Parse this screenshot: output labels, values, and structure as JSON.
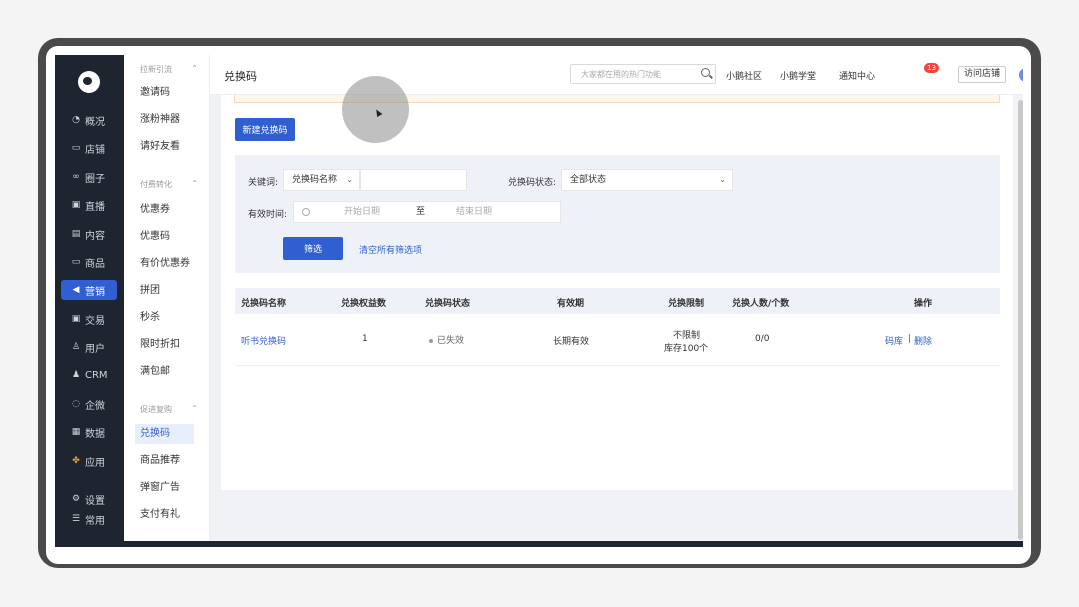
{
  "primary_nav": [
    {
      "label": "概况",
      "icon": "overview-icon"
    },
    {
      "label": "店铺",
      "icon": "store-icon"
    },
    {
      "label": "圈子",
      "icon": "circle-icon"
    },
    {
      "label": "直播",
      "icon": "live-icon"
    },
    {
      "label": "内容",
      "icon": "content-icon"
    },
    {
      "label": "商品",
      "icon": "goods-icon"
    },
    {
      "label": "营销",
      "icon": "marketing-icon",
      "active": true
    },
    {
      "label": "交易",
      "icon": "trade-icon"
    },
    {
      "label": "用户",
      "icon": "user-icon"
    },
    {
      "label": "CRM",
      "icon": "crm-icon"
    },
    {
      "label": "企微",
      "icon": "wecom-icon"
    },
    {
      "label": "数据",
      "icon": "data-icon"
    },
    {
      "label": "应用",
      "icon": "apps-icon"
    },
    {
      "label": "设置",
      "icon": "settings-icon"
    },
    {
      "label": "常用",
      "icon": "menu-icon"
    }
  ],
  "secondary_nav": {
    "groups": [
      "拉新引流",
      "付费转化",
      "促进复购"
    ],
    "items": [
      "邀请码",
      "涨粉神器",
      "请好友看",
      "优惠券",
      "优惠码",
      "有价优惠券",
      "拼团",
      "秒杀",
      "限时折扣",
      "满包邮",
      "兑换码",
      "商品推荐",
      "弹窗广告",
      "支付有礼"
    ],
    "active": "兑换码"
  },
  "header": {
    "title": "兑换码",
    "search_placeholder": "大家都在用的热门功能",
    "links": [
      "小鹅社区",
      "小鹅学堂",
      "通知中心"
    ],
    "notify_count": "13",
    "visit_store": "访问店铺"
  },
  "toolbar": {
    "new_button": "新建兑换码"
  },
  "filter": {
    "keyword_label": "关键词:",
    "keyword_type": "兑换码名称",
    "status_label": "兑换码状态:",
    "status_value": "全部状态",
    "time_label": "有效时间:",
    "start_placeholder": "开始日期",
    "to_text": "至",
    "end_placeholder": "结束日期",
    "filter_button": "筛选",
    "clear_link": "清空所有筛选项"
  },
  "table": {
    "columns": [
      "兑换码名称",
      "兑换权益数",
      "兑换码状态",
      "有效期",
      "兑换限制",
      "兑换人数/个数",
      "操作"
    ],
    "rows": [
      {
        "name": "听书兑换码",
        "benefits": "1",
        "status": "已失效",
        "validity": "长期有效",
        "limit_line1": "不限制",
        "limit_line2": "库存100个",
        "count": "0/0",
        "action_library": "码库",
        "action_sep": "|",
        "action_delete": "删除"
      }
    ]
  },
  "colors": {
    "accent": "#2f5fd0",
    "sidebar": "#1e2430",
    "filter_bg": "#eef2f8"
  }
}
